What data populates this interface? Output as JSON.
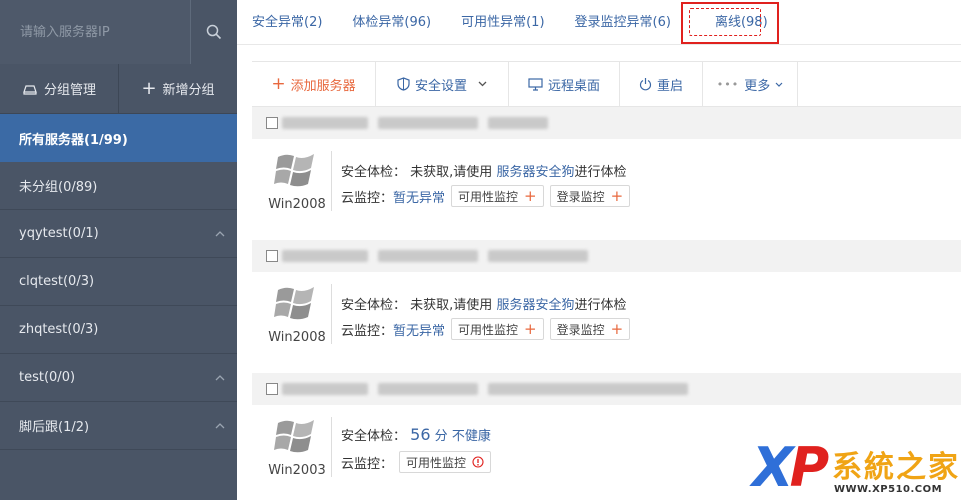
{
  "sidebar": {
    "search_placeholder": "请输入服务器IP",
    "group_manage_label": "分组管理",
    "add_group_label": "新增分组",
    "items": [
      {
        "label": "所有服务器(1/99)"
      },
      {
        "label": "未分组(0/89)"
      },
      {
        "label": "yqytest(0/1)"
      },
      {
        "label": "clqtest(0/3)"
      },
      {
        "label": "zhqtest(0/3)"
      },
      {
        "label": "test(0/0)"
      },
      {
        "label": "脚后跟(1/2)"
      }
    ]
  },
  "tabs": [
    {
      "label": "安全异常(2)"
    },
    {
      "label": "体检异常(96)"
    },
    {
      "label": "可用性异常(1)"
    },
    {
      "label": "登录监控异常(6)"
    },
    {
      "label": "离线(98)"
    }
  ],
  "toolbar": {
    "add_server": "添加服务器",
    "security_settings": "安全设置",
    "remote_desktop": "远程桌面",
    "restart": "重启",
    "more": "更多"
  },
  "servers": [
    {
      "os": "Win2008",
      "check_label": "安全体检：",
      "check_text": "未获取,请使用",
      "check_link": "服务器安全狗",
      "check_suffix": "进行体检",
      "cloud_label": "云监控：",
      "cloud_status": "暂无异常",
      "availability": "可用性监控",
      "login_monitor": "登录监控"
    },
    {
      "os": "Win2008",
      "check_label": "安全体检：",
      "check_text": "未获取,请使用",
      "check_link": "服务器安全狗",
      "check_suffix": "进行体检",
      "cloud_label": "云监控：",
      "cloud_status": "暂无异常",
      "availability": "可用性监控",
      "login_monitor": "登录监控"
    },
    {
      "os": "Win2003",
      "check_label": "安全体检：",
      "score": "56",
      "score_unit": "分",
      "health": "不健康",
      "cloud_label": "云监控：",
      "availability": "可用性监控"
    }
  ],
  "watermark": {
    "logo_text": "XP系统之家",
    "url": "WWW.XP510.COM"
  }
}
